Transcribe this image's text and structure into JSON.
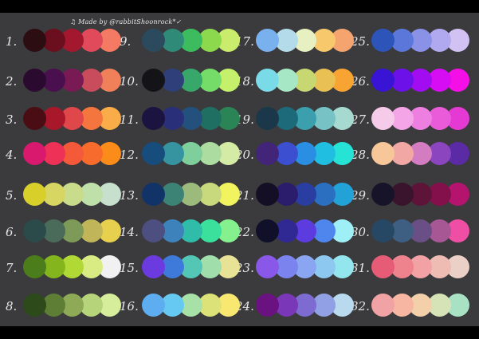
{
  "credit": "♫ Made by @rabbitShoonrock*✓",
  "palettes": [
    {
      "label": "1.",
      "colors": [
        "#2b0d12",
        "#6b0f1f",
        "#a3182f",
        "#e04a5a",
        "#f47a63"
      ]
    },
    {
      "label": "2.",
      "colors": [
        "#2a0a2e",
        "#4a0f4f",
        "#7a1a55",
        "#c94c5c",
        "#f0805a"
      ]
    },
    {
      "label": "3.",
      "colors": [
        "#4a0d14",
        "#a8182a",
        "#e0474a",
        "#f4763e",
        "#f9ac48"
      ]
    },
    {
      "label": "4.",
      "colors": [
        "#d8196d",
        "#ee3156",
        "#f45a3a",
        "#f76c2c",
        "#fb8c1a"
      ]
    },
    {
      "label": "5.",
      "colors": [
        "#d9cf2b",
        "#d7d662",
        "#c9dc8b",
        "#bfe0a9",
        "#c7dfcd"
      ]
    },
    {
      "label": "6.",
      "colors": [
        "#2a4b49",
        "#4a6b59",
        "#7d9a58",
        "#c0b659",
        "#e7d04e"
      ]
    },
    {
      "label": "7.",
      "colors": [
        "#4c7d1b",
        "#84b51d",
        "#b1d936",
        "#d9ec84",
        "#f0f1f0"
      ]
    },
    {
      "label": "8.",
      "colors": [
        "#2d4b1a",
        "#5e7e36",
        "#8faa56",
        "#b6d57a",
        "#d6ee9b"
      ]
    },
    {
      "label": "9.",
      "colors": [
        "#2b4a5e",
        "#2f8a77",
        "#3cbc5e",
        "#8cd94e",
        "#c9ec6c"
      ]
    },
    {
      "label": "10.",
      "colors": [
        "#141318",
        "#2e3f7a",
        "#37a86a",
        "#75dc6a",
        "#c4f06c"
      ]
    },
    {
      "label": "11.",
      "colors": [
        "#1b1440",
        "#2a2f7a",
        "#23507c",
        "#1f6f63",
        "#2b8456"
      ]
    },
    {
      "label": "12.",
      "colors": [
        "#164d7c",
        "#3693a0",
        "#7ecf9b",
        "#addca0",
        "#d4eba6"
      ]
    },
    {
      "label": "13.",
      "colors": [
        "#123367",
        "#3c8275",
        "#9dba7d",
        "#c7d87d",
        "#f1f45e"
      ]
    },
    {
      "label": "14.",
      "colors": [
        "#4c4f80",
        "#3e82bb",
        "#2fbca9",
        "#3ae09c",
        "#85f08e"
      ]
    },
    {
      "label": "15.",
      "colors": [
        "#6b3be0",
        "#3d7ad9",
        "#53c6b6",
        "#a0deac",
        "#e8e296"
      ]
    },
    {
      "label": "16.",
      "colors": [
        "#5dadf0",
        "#66c9f2",
        "#a8e1a8",
        "#dde278",
        "#f8e871"
      ]
    },
    {
      "label": "17.",
      "colors": [
        "#79b0ee",
        "#b3dbea",
        "#e7f0c0",
        "#f8c86c",
        "#f6a46f"
      ]
    },
    {
      "label": "18.",
      "colors": [
        "#7adbe8",
        "#a6e8c5",
        "#c7d772",
        "#e8c053",
        "#f7a432"
      ]
    },
    {
      "label": "19.",
      "colors": [
        "#1a3849",
        "#1c6a7a",
        "#3b9fae",
        "#76c2c4",
        "#a6d9cf"
      ]
    },
    {
      "label": "20.",
      "colors": [
        "#422479",
        "#3c4fd1",
        "#2a8fe3",
        "#20bfe2",
        "#27e3d6"
      ]
    },
    {
      "label": "21.",
      "colors": [
        "#150f25",
        "#2c1d6c",
        "#2a3ea2",
        "#2b6fc1",
        "#23a2d7"
      ]
    },
    {
      "label": "22.",
      "colors": [
        "#10102b",
        "#302994",
        "#5d3cdf",
        "#4f86ee",
        "#9ff0f6"
      ]
    },
    {
      "label": "23.",
      "colors": [
        "#8a58e9",
        "#7b84ee",
        "#8aa6f2",
        "#8dc8f1",
        "#94e6ee"
      ]
    },
    {
      "label": "24.",
      "colors": [
        "#6a127f",
        "#7a38b8",
        "#7d6bd2",
        "#91a0e4",
        "#b8d9ee"
      ]
    },
    {
      "label": "25.",
      "colors": [
        "#2d54b9",
        "#5a77d9",
        "#8a92e8",
        "#b0a9ef",
        "#d2c2f4"
      ]
    },
    {
      "label": "26.",
      "colors": [
        "#3914d5",
        "#6c12e8",
        "#a20cf0",
        "#d60df2",
        "#f40fe7"
      ]
    },
    {
      "label": "27.",
      "colors": [
        "#f6cbe9",
        "#f4a5e7",
        "#ed7fe0",
        "#e95bd9",
        "#e43ad3"
      ]
    },
    {
      "label": "28.",
      "colors": [
        "#f7c79a",
        "#f1a8a5",
        "#d47cc1",
        "#8a45bf",
        "#5b2aa5"
      ]
    },
    {
      "label": "29.",
      "colors": [
        "#17142a",
        "#3a142c",
        "#5e1339",
        "#84104b",
        "#b4146d"
      ]
    },
    {
      "label": "30.",
      "colors": [
        "#274865",
        "#3e5f82",
        "#694f85",
        "#a85795",
        "#ee4ea4"
      ]
    },
    {
      "label": "31.",
      "colors": [
        "#e65c76",
        "#ee838d",
        "#f2a2a4",
        "#efbcb4",
        "#ead0c6"
      ]
    },
    {
      "label": "32.",
      "colors": [
        "#f1a2a5",
        "#f6b6a2",
        "#f3d0aa",
        "#d6e3b6",
        "#a8e1c4"
      ]
    }
  ]
}
